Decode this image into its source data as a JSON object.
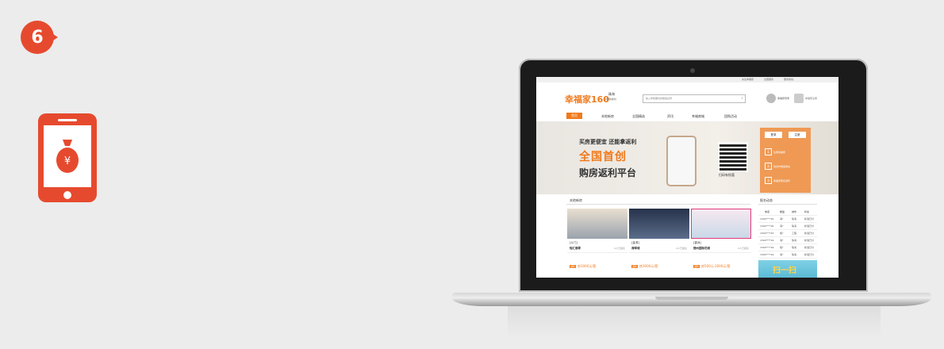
{
  "step": {
    "number": "6"
  },
  "site": {
    "top_links": [
      "关注幸福家",
      "全国服务",
      "服务热线："
    ],
    "logo": "幸福家160",
    "city": "珠海",
    "city_switch": "[切换城市]",
    "search_placeholder": "输入你想要找的楼盘名称",
    "login": "幸福家登录",
    "register": "幸福家注册",
    "nav": [
      "首页",
      "本地新房",
      "全国精选",
      "资讯",
      "幸福商城",
      "团购活动"
    ],
    "banner": {
      "line1": "买房更便宜 还能拿返利",
      "line2": "全国首创",
      "line3": "购房返利平台",
      "qr_caption": "扫码有惊喜",
      "tabs": [
        "登录",
        "注册"
      ],
      "steps": [
        {
          "num": "1",
          "text": "注册幸福家"
        },
        {
          "num": "2",
          "text": "到合作楼盘购房"
        },
        {
          "num": "3",
          "text": "幸福家帮您返利"
        }
      ]
    },
    "section_local": "本地新房",
    "section_signup": "报名动态",
    "cards": [
      {
        "district": "[斗门]",
        "name": "恒汇翡翠",
        "fans": "0人已报名",
        "price": "房3000元/套"
      },
      {
        "district": "[金湾]",
        "name": "海琴城",
        "fans": "0人已报名",
        "price": "房3000元/套"
      },
      {
        "district": "[香洲]",
        "name": "德州国际花城",
        "fans": "0人已报名",
        "price": "房500元-2000元/套"
      }
    ],
    "signup_headers": [
      "电话",
      "楼盘",
      "城市",
      "状态"
    ],
    "signup_rows": [
      [
        "1560****90",
        "海*",
        "珠海",
        "新浪已付"
      ],
      [
        "1560****90",
        "海*",
        "珠海",
        "新浪已付"
      ],
      [
        "1560****63",
        "恒*",
        "工程",
        "新浪已付"
      ],
      [
        "1560****49",
        "海*",
        "珠海",
        "新浪已付"
      ],
      [
        "1560****49",
        "恒*",
        "珠海",
        "新浪已付"
      ],
      [
        "1560****49",
        "海*",
        "珠海",
        "新浪已付"
      ]
    ],
    "ad_text": "扫一扫"
  },
  "colors": {
    "accent": "#e64a2e",
    "site_orange": "#f07a1c"
  }
}
